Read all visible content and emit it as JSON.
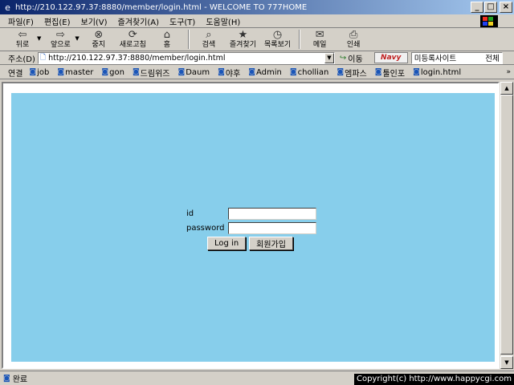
{
  "window": {
    "title": "http://210.122.97.37:8880/member/login.html - WELCOME TO 777HOME",
    "minimize": "_",
    "maximize": "□",
    "close": "×"
  },
  "menu": [
    "파일(F)",
    "편집(E)",
    "보기(V)",
    "즐겨찾기(A)",
    "도구(T)",
    "도움말(H)"
  ],
  "toolbar": [
    {
      "label": "뒤로",
      "icon": "back-arrow-icon",
      "glyph": "⇦"
    },
    {
      "label": "앞으로",
      "icon": "forward-arrow-icon",
      "glyph": "⇨"
    },
    {
      "label": "중지",
      "icon": "stop-icon",
      "glyph": "⊗"
    },
    {
      "label": "새로고침",
      "icon": "refresh-icon",
      "glyph": "⟳"
    },
    {
      "label": "홈",
      "icon": "home-icon",
      "glyph": "⌂"
    },
    {
      "label": "검색",
      "icon": "search-icon",
      "glyph": "⌕"
    },
    {
      "label": "즐겨찾기",
      "icon": "favorites-icon",
      "glyph": "★"
    },
    {
      "label": "목록보기",
      "icon": "history-icon",
      "glyph": "◷"
    },
    {
      "label": "메일",
      "icon": "mail-icon",
      "glyph": "✉"
    },
    {
      "label": "인쇄",
      "icon": "print-icon",
      "glyph": "⎙"
    }
  ],
  "address": {
    "label": "주소(D)",
    "url": "http://210.122.97.37:8880/member/login.html",
    "go": "이동",
    "navy_logo": "Navy",
    "navy_text": "미등록사이트",
    "navy_extra": "전체"
  },
  "links": {
    "label": "연결",
    "items": [
      "job",
      "master",
      "gon",
      "드림위즈",
      "Daum",
      "야후",
      "Admin",
      "chollian",
      "엠파스",
      "툴인포",
      "login.html"
    ]
  },
  "login": {
    "id_label": "id",
    "password_label": "password",
    "login_button": "Log in",
    "register_button": "회원가입"
  },
  "status": {
    "text": "완료",
    "copyright": "Copyright(c) http://www.happycgi.com"
  },
  "colors": {
    "page_background": "#87ceeb",
    "titlebar_start": "#0a246a",
    "titlebar_end": "#a6caf0"
  }
}
